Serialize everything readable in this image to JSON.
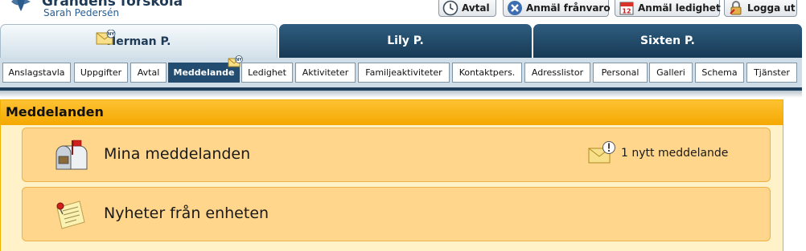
{
  "header": {
    "site_title": "Grändens förskola",
    "user_name": "Sarah Pedersén",
    "buttons": [
      {
        "label": "Avtal",
        "icon": "clock-icon"
      },
      {
        "label": "Anmäl frånvaro",
        "icon": "x-circle-icon"
      },
      {
        "label": "Anmäl ledighet",
        "icon": "calendar-icon"
      },
      {
        "label": "Logga ut",
        "icon": "padlock-icon"
      }
    ]
  },
  "child_tabs": [
    {
      "label": "Herman P.",
      "active": true,
      "new_badge": "NY"
    },
    {
      "label": "Lily P.",
      "active": false
    },
    {
      "label": "Sixten P.",
      "active": false
    }
  ],
  "subnav": {
    "active": "Meddelande",
    "new_badge": "NY",
    "items": [
      "Anslagstavla",
      "Uppgifter",
      "Avtal",
      "Meddelande",
      "Ledighet",
      "Aktiviteter",
      "Familjeaktiviteter",
      "Kontaktpers.",
      "Adresslistor",
      "Personal",
      "Galleri",
      "Schema",
      "Tjänster"
    ]
  },
  "panel": {
    "title": "Meddelanden",
    "cards": [
      {
        "title": "Mina meddelanden",
        "icon": "mailbox-icon",
        "badge_text": "1 nytt meddelande",
        "badge_icon": "new-message-envelope-icon"
      },
      {
        "title": "Nyheter från enheten",
        "icon": "pinned-note-icon"
      }
    ]
  },
  "colors": {
    "brand_dark": "#1f3a57",
    "tab_active_fill": "#234d70",
    "panel_header": "#f5a800",
    "card_fill": "#ffd68b"
  }
}
